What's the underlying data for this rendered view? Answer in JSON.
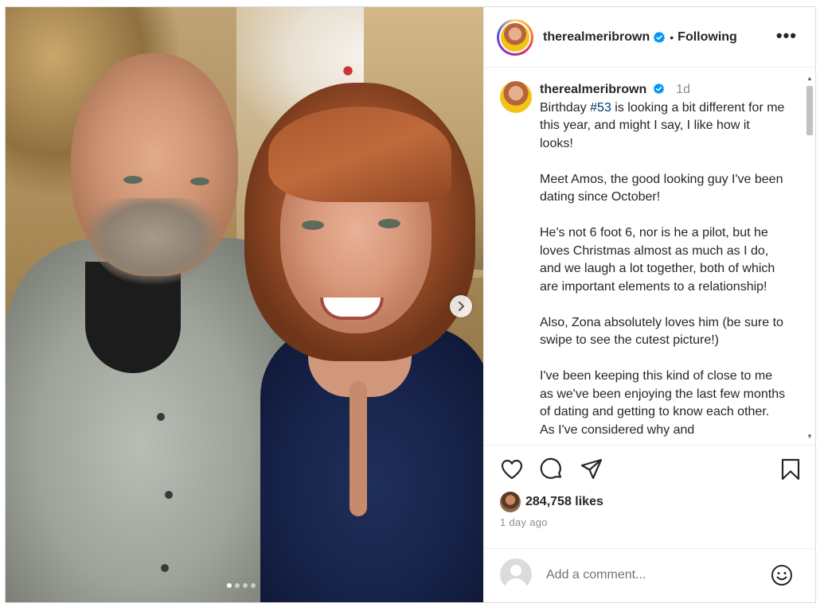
{
  "post": {
    "username": "therealmeribrown",
    "separator": "•",
    "follow_status": "Following",
    "more_label": "•••",
    "caption_time": "1d",
    "caption": {
      "line1_prefix": "Birthday ",
      "hashtag": "#53",
      "line1_suffix": " is looking a bit different for me this year, and might I say, I like how it looks!",
      "para2": "Meet Amos, the good looking guy I've been dating since October!",
      "para3": "He's not 6 foot 6, nor is he a pilot, but he loves Christmas almost as much as I do, and we laugh a lot together, both of which are important elements to a relationship!",
      "para4": "Also, Zona absolutely loves him (be sure to swipe to see the cutest picture!)",
      "para5": "I've been keeping this kind of close to me as we've been enjoying the last few months of dating and getting to know each other. As I've considered why and"
    },
    "likes": "284,758 likes",
    "time_ago": "1 day ago",
    "comment_placeholder": "Add a comment..."
  },
  "carousel": {
    "slide_count": 4,
    "active_index": 0
  },
  "icons": {
    "header": [
      "verified-badge-icon",
      "more-options-icon"
    ],
    "actions": [
      "heart-icon",
      "comment-icon",
      "share-icon",
      "bookmark-icon"
    ],
    "comment": [
      "emoji-icon"
    ],
    "photo": [
      "chevron-right-icon"
    ]
  },
  "colors": {
    "verified": "#0095f6",
    "hashtag": "#00376b",
    "muted": "#8e8e8e",
    "text": "#262626"
  }
}
